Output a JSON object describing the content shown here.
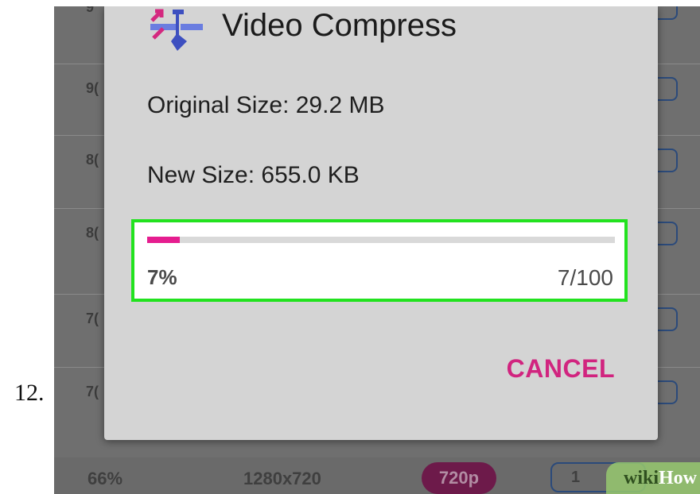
{
  "step_number": "12.",
  "background_list": {
    "rows": [
      {
        "value": "9"
      },
      {
        "value": "9("
      },
      {
        "value": "8("
      },
      {
        "value": "8("
      },
      {
        "value": "7("
      },
      {
        "value": "7("
      }
    ],
    "bottom_row": {
      "percent": "66%",
      "resolution": "1280x720",
      "quality_badge": "720p",
      "outline_value": "1"
    }
  },
  "dialog": {
    "icon": "video-compress-icon",
    "title": "Video Compress",
    "original_size": "Original Size:  29.2 MB",
    "new_size": "New Size:  655.0 KB",
    "progress": {
      "percent_label": "7%",
      "count_label": "7/100",
      "fraction": 0.07
    },
    "cancel_label": "CANCEL"
  },
  "watermark": {
    "part1": "wiki",
    "part2": "How"
  },
  "colors": {
    "accent": "#e51d8f",
    "cancel": "#d1247f",
    "highlight": "#22e21f",
    "badge": "#6d1a4a"
  }
}
